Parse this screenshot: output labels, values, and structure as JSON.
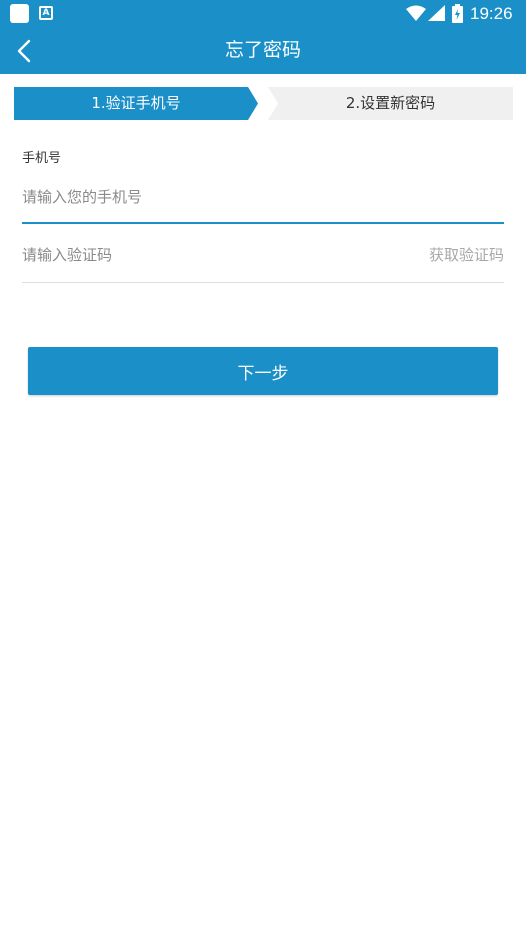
{
  "status_bar": {
    "time": "19:26",
    "icons": [
      "app-notification-icon",
      "a-keyboard-icon",
      "wifi-icon",
      "cellular-signal-icon",
      "battery-charging-icon"
    ]
  },
  "app_bar": {
    "title": "忘了密码",
    "back_icon": "chevron-left-icon"
  },
  "steps": [
    {
      "label": "1.验证手机号",
      "active": true
    },
    {
      "label": "2.设置新密码",
      "active": false
    }
  ],
  "form": {
    "phone_label": "手机号",
    "phone_placeholder": "请输入您的手机号",
    "code_placeholder": "请输入验证码",
    "get_code_label": "获取验证码"
  },
  "next_button_label": "下一步",
  "colors": {
    "primary": "#1a8fc8",
    "inactive_step": "#f0f0f0",
    "divider": "#dddddd"
  }
}
